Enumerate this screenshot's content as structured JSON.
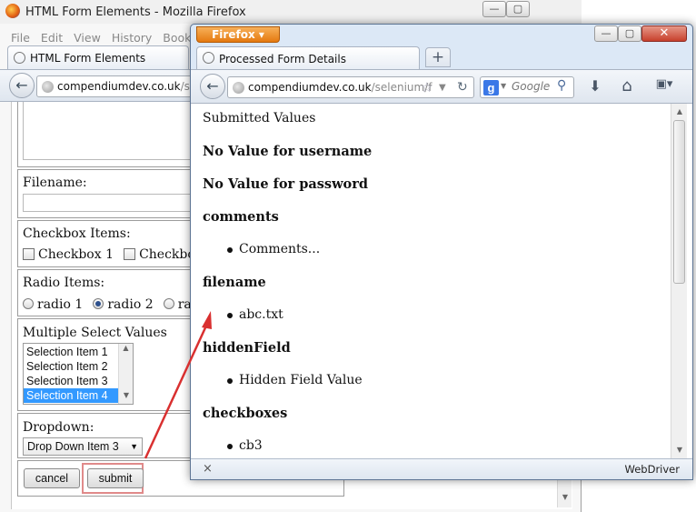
{
  "back_window": {
    "title": "HTML Form Elements - Mozilla Firefox",
    "menu": [
      "File",
      "Edit",
      "View",
      "History",
      "Bookmarks"
    ],
    "tab_label": "HTML Form Elements",
    "url_host": "compendiumdev.co.uk",
    "url_path": "/sele",
    "form": {
      "filename_label": "Filename:",
      "checkbox_label": "Checkbox Items:",
      "checkboxes": [
        "Checkbox 1",
        "Checkbox"
      ],
      "radio_label": "Radio Items:",
      "radios": [
        "radio 1",
        "radio 2",
        "radio"
      ],
      "radio_selected": 1,
      "multiselect_label": "Multiple Select Values",
      "multiselect_items": [
        "Selection Item 1",
        "Selection Item 2",
        "Selection Item 3",
        "Selection Item 4"
      ],
      "multiselect_selected": 3,
      "dropdown_label": "Dropdown:",
      "dropdown_value": "Drop Down Item 3",
      "cancel_label": "cancel",
      "submit_label": "submit"
    }
  },
  "front_window": {
    "firefox_button": "Firefox",
    "tab_label": "Processed Form Details",
    "new_tab": "+",
    "url_host": "compendiumdev.co.uk",
    "url_path": "/selenium/f",
    "search_placeholder": "Google",
    "statusbar_text": "WebDriver",
    "content": {
      "heading": "Submitted Values",
      "no_username": "No Value for username",
      "no_password": "No Value for password",
      "sections": [
        {
          "name": "comments",
          "value": "Comments..."
        },
        {
          "name": "filename",
          "value": "abc.txt"
        },
        {
          "name": "hiddenField",
          "value": "Hidden Field Value"
        },
        {
          "name": "checkboxes",
          "value": "cb3"
        }
      ]
    }
  },
  "colors": {
    "accent_firefox": "#e57a10",
    "selection_blue": "#3399ff",
    "annotation_red": "#d93030"
  }
}
